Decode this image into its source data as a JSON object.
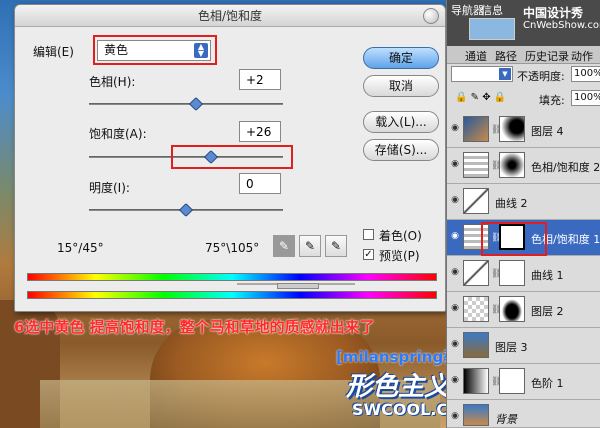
{
  "dialog": {
    "title": "色相/饱和度",
    "edit_label": "编辑(E)",
    "edit_value": "黄色",
    "hue_label": "色相(H):",
    "hue_value": "+2",
    "saturation_label": "饱和度(A):",
    "saturation_value": "+26",
    "lightness_label": "明度(I):",
    "lightness_value": "0",
    "ok": "确定",
    "cancel": "取消",
    "load": "载入(L)...",
    "save": "存储(S)...",
    "colorize_label": "着色(O)",
    "preview_label": "预览(P)",
    "preview_checked": true,
    "colorize_checked": false,
    "range_left": "15°/45°",
    "range_right": "75°\\105°",
    "hue_slider_fraction": 0.55,
    "saturation_slider_fraction": 0.63,
    "lightness_slider_fraction": 0.5
  },
  "caption": "6选中黄色 提高饱和度，整个马和草地的质感就出来了",
  "watermark": {
    "line1": "[milanspring教程]",
    "line2": "形色主义",
    "line3": "SWCOOL.COM"
  },
  "panel": {
    "top_tab1": "导航器",
    "top_tab2": "信息",
    "site_name": "中国设计秀",
    "site_url": "CnWebShow.com",
    "tabs": [
      "通道",
      "路径",
      "历史记录",
      "动作"
    ],
    "opacity_label": "不透明度:",
    "opacity_value": "100%",
    "fill_label": "填充:",
    "fill_value": "100%",
    "layers": [
      {
        "name": "图层 4",
        "selected": false
      },
      {
        "name": "色相/饱和度 2",
        "selected": false
      },
      {
        "name": "曲线 2",
        "selected": false
      },
      {
        "name": "色相/饱和度 1",
        "selected": true
      },
      {
        "name": "曲线 1",
        "selected": false
      },
      {
        "name": "图层 2",
        "selected": false
      },
      {
        "name": "图层 3",
        "selected": false
      },
      {
        "name": "色阶 1",
        "selected": false
      },
      {
        "name": "背景",
        "selected": false
      }
    ]
  }
}
